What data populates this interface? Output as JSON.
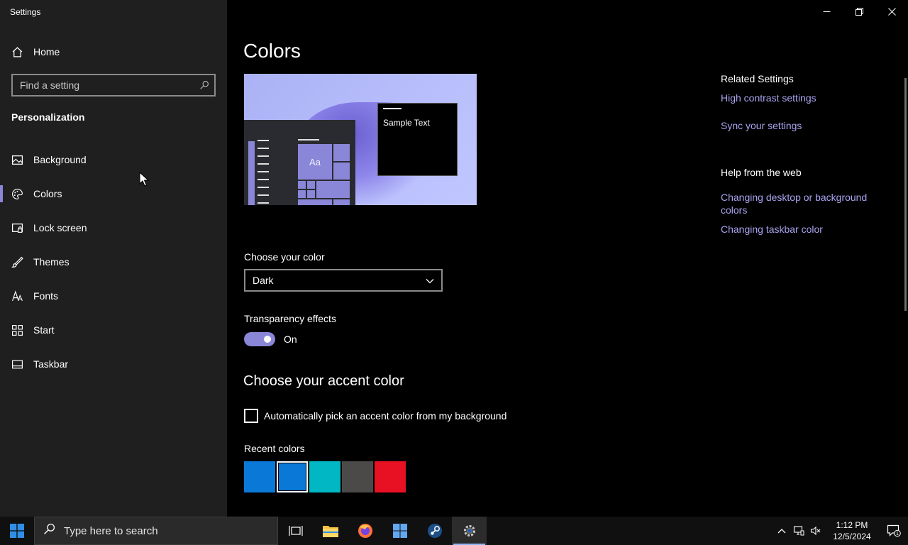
{
  "window": {
    "title": "Settings"
  },
  "sidebar": {
    "home_label": "Home",
    "search_placeholder": "Find a setting",
    "section_title": "Personalization",
    "items": [
      {
        "label": "Background",
        "icon": "image-icon",
        "active": false
      },
      {
        "label": "Colors",
        "icon": "palette-icon",
        "active": true
      },
      {
        "label": "Lock screen",
        "icon": "lock-screen-icon",
        "active": false
      },
      {
        "label": "Themes",
        "icon": "brush-icon",
        "active": false
      },
      {
        "label": "Fonts",
        "icon": "font-icon",
        "active": false
      },
      {
        "label": "Start",
        "icon": "start-grid-icon",
        "active": false
      },
      {
        "label": "Taskbar",
        "icon": "taskbar-icon",
        "active": false
      }
    ]
  },
  "main": {
    "title": "Colors",
    "preview": {
      "sample_text": "Sample Text",
      "tile_text": "Aa"
    },
    "choose_color_label": "Choose your color",
    "choose_color_value": "Dark",
    "transparency_label": "Transparency effects",
    "transparency_state": "On",
    "accent_heading": "Choose your accent color",
    "auto_accent_label": "Automatically pick an accent color from my background",
    "recent_colors_label": "Recent colors",
    "recent_colors": [
      "#0a78d7",
      "#0a78d7",
      "#00b7c3",
      "#4c4a48",
      "#e81123"
    ],
    "selected_recent_index": 1
  },
  "related": {
    "related_header": "Related Settings",
    "links": [
      "High contrast settings",
      "Sync your settings"
    ],
    "help_header": "Help from the web",
    "help_links": [
      "Changing desktop or background colors",
      "Changing taskbar color"
    ]
  },
  "taskbar": {
    "search_placeholder": "Type here to search",
    "time": "1:12 PM",
    "date": "12/5/2024",
    "notification_count": "1"
  },
  "colors": {
    "accent": "#8a86d8",
    "link": "#a9a4f0",
    "sidebar_bg": "#1f1f1f"
  }
}
